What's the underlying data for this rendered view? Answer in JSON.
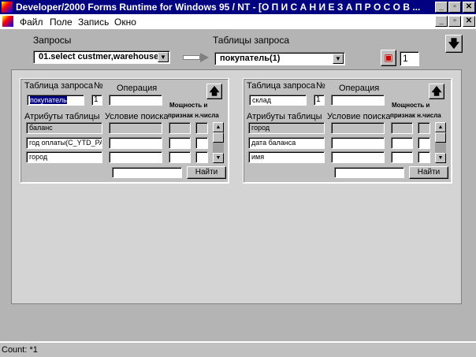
{
  "window": {
    "title": "Developer/2000 Forms Runtime for Windows 95 / NT - [О П И С А Н И Е     З А П Р О С О В   ..."
  },
  "menu": [
    "Файл",
    "Поле",
    "Запись",
    "Окно"
  ],
  "top": {
    "queries_label": "Запросы",
    "query_value": "01.select custmer,warehouse",
    "tables_label": "Таблицы запроса",
    "table_value": "покупатель(1)",
    "count_value": "1"
  },
  "panels": [
    {
      "table_label": "Таблица запроса",
      "no_label": "№",
      "operation_label": "Операция",
      "table_value": "покупатель",
      "no_value": "1",
      "operation_value": "",
      "power_label1": "Мощность и",
      "power_label2": "признак н.числа",
      "attrs_label": "Атрибуты таблицы",
      "cond_label": "Условие поиска",
      "rows": [
        "баланс",
        "год оплаты(C_YTD_PAY",
        "город"
      ],
      "find_label": "Найти"
    },
    {
      "table_label": "Таблица запроса",
      "no_label": "№",
      "operation_label": "Операция",
      "table_value": "склад",
      "no_value": "1",
      "operation_value": "",
      "power_label1": "Мощность и",
      "power_label2": "признак н.числа",
      "attrs_label": "Атрибуты таблицы",
      "cond_label": "Условие поиска",
      "rows": [
        "город",
        "дата баланса",
        "имя"
      ],
      "find_label": "Найти"
    }
  ],
  "status": {
    "text": "Count: *1"
  }
}
